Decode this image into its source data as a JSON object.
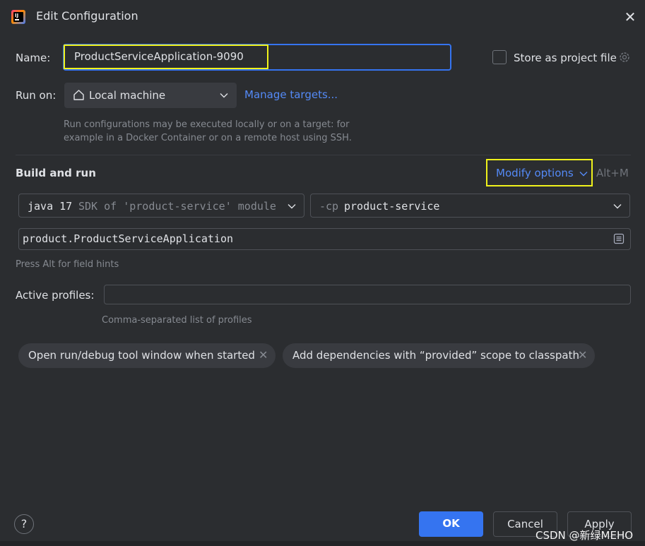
{
  "window": {
    "title": "Edit Configuration"
  },
  "name": {
    "label": "Name:",
    "value": "ProductServiceApplication-9090"
  },
  "store": {
    "label": "Store as project file",
    "checked": false
  },
  "run_on": {
    "label": "Run on:",
    "selected": "Local machine",
    "manage_link": "Manage targets...",
    "hint_line1": "Run configurations may be executed locally or on a target: for",
    "hint_line2": "example in a Docker Container or on a remote host using SSH."
  },
  "build_and_run": {
    "title": "Build and run",
    "modify_options": "Modify options",
    "modify_shortcut": "Alt+M",
    "sdk_java": "java 17",
    "sdk_rest": "SDK of 'product-service' module",
    "cp_prefix": "-cp",
    "cp_value": "product-service",
    "main_class": "product.ProductServiceApplication",
    "field_hint": "Press Alt for field hints"
  },
  "profiles": {
    "label": "Active profiles:",
    "value": "",
    "hint": "Comma-separated list of profiles"
  },
  "chips": [
    {
      "label": "Open run/debug tool window when started"
    },
    {
      "label": "Add dependencies with “provided” scope to classpath"
    }
  ],
  "footer": {
    "help": "?",
    "ok": "OK",
    "cancel": "Cancel",
    "apply": "Apply"
  },
  "watermark": "CSDN @新绿MEHO",
  "colors": {
    "background": "#2b2d30",
    "accent": "#3574f0",
    "link": "#548af7",
    "highlight": "#f0f21b"
  }
}
